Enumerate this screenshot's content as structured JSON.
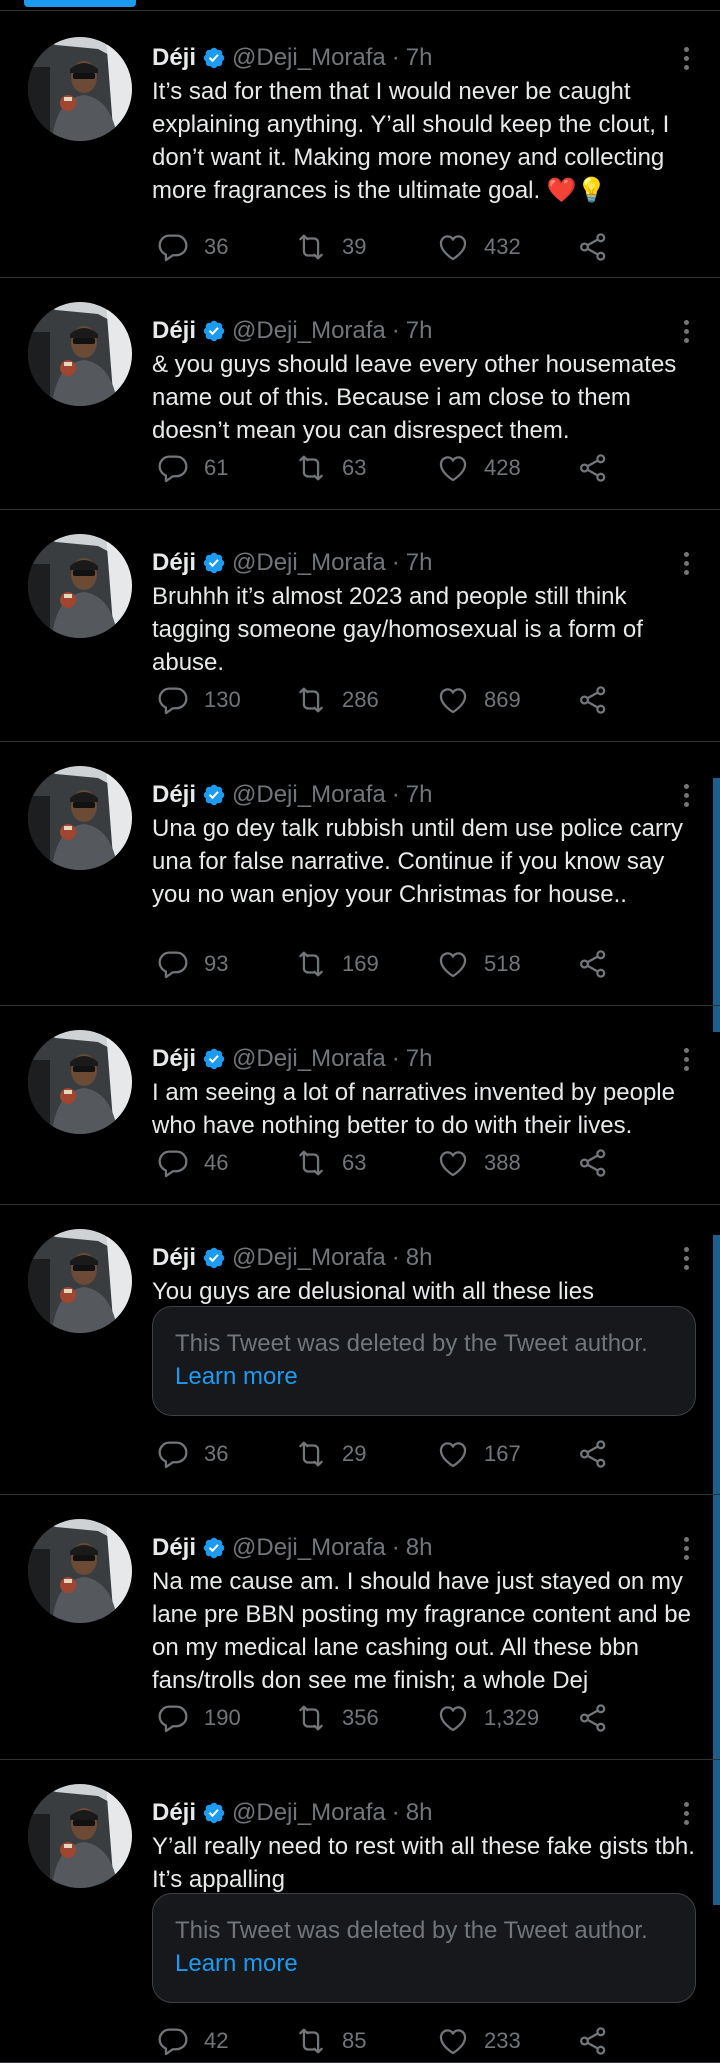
{
  "colors": {
    "background": "#000000",
    "accent": "#1d9bf0",
    "text": "#e7e9ea",
    "muted": "#71767b",
    "verified": "#1d9bf0",
    "heart": "#f91880"
  },
  "icons": {
    "reply": "speech-bubble-icon",
    "retweet": "retweet-icon",
    "like": "heart-icon",
    "share": "share-icon",
    "more": "three-dots-vertical-icon",
    "verified": "verified-badge-icon"
  },
  "tweets": [
    {
      "name": "Déji",
      "handle": "@Deji_Morafa",
      "dot": "·",
      "time": "7h",
      "text": "It’s sad for them that I would never be caught explaining anything. Y’all should keep the clout, I don’t want it. Making more money and collecting more fragrances is the ultimate goal. ❤️💡",
      "replies": "36",
      "retweets": "39",
      "likes": "432"
    },
    {
      "name": "Déji",
      "handle": "@Deji_Morafa",
      "dot": "·",
      "time": "7h",
      "text": "& you guys should leave every other housemates name out of this. Because i am close to them doesn’t mean you can disrespect them.",
      "replies": "61",
      "retweets": "63",
      "likes": "428"
    },
    {
      "name": "Déji",
      "handle": "@Deji_Morafa",
      "dot": "·",
      "time": "7h",
      "text": "Bruhhh it’s almost 2023 and people still think tagging someone gay/homosexual is a form of abuse.",
      "replies": "130",
      "retweets": "286",
      "likes": "869"
    },
    {
      "name": "Déji",
      "handle": "@Deji_Morafa",
      "dot": "·",
      "time": "7h",
      "text": "Una go dey talk rubbish until dem use police carry una for false narrative. Continue if you know say you no wan enjoy your Christmas for house..",
      "replies": "93",
      "retweets": "169",
      "likes": "518"
    },
    {
      "name": "Déji",
      "handle": "@Deji_Morafa",
      "dot": "·",
      "time": "7h",
      "text": "I am seeing a lot of narratives invented by people who have nothing better to do with their lives.",
      "replies": "46",
      "retweets": "63",
      "likes": "388"
    },
    {
      "name": "Déji",
      "handle": "@Deji_Morafa",
      "dot": "·",
      "time": "8h",
      "text": "You guys are delusional with all these lies",
      "deleted_text": "This Tweet was deleted by the Tweet author.",
      "learn_more": "Learn more",
      "replies": "36",
      "retweets": "29",
      "likes": "167"
    },
    {
      "name": "Déji",
      "handle": "@Deji_Morafa",
      "dot": "·",
      "time": "8h",
      "text": "Na me cause am. I should have just stayed on my lane pre BBN posting my fragrance content and be on my medical lane cashing out. All these bbn fans/trolls don see me finish; a whole Dej",
      "replies": "190",
      "retweets": "356",
      "likes": "1,329"
    },
    {
      "name": "Déji",
      "handle": "@Deji_Morafa",
      "dot": "·",
      "time": "8h",
      "text": "Y’all really need to rest with all these fake gists tbh. It’s appalling",
      "deleted_text": "This Tweet was deleted by the Tweet author.",
      "learn_more": "Learn more",
      "replies": "42",
      "retweets": "85",
      "likes": "233"
    }
  ]
}
